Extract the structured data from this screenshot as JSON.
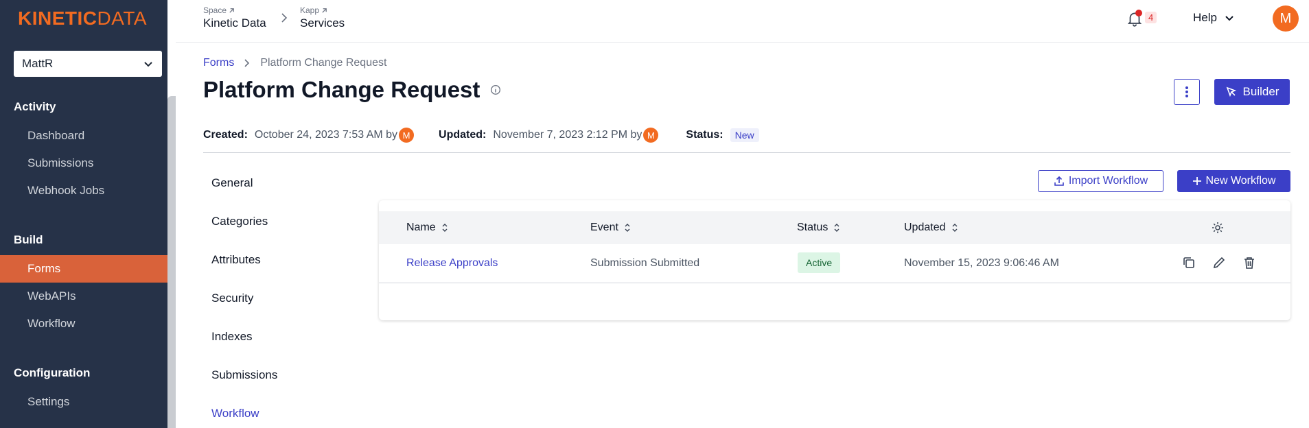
{
  "brand": {
    "logo_bold": "KINETIC",
    "logo_light": "DATA"
  },
  "space_select": {
    "value": "MattR"
  },
  "sidebar": {
    "sections": [
      {
        "title": "Activity",
        "items": [
          "Dashboard",
          "Submissions",
          "Webhook Jobs"
        ]
      },
      {
        "title": "Build",
        "items": [
          "Forms",
          "WebAPIs",
          "Workflow"
        ]
      },
      {
        "title": "Configuration",
        "items": [
          "Settings"
        ]
      }
    ],
    "active_item": "Forms"
  },
  "topbar": {
    "space_label": "Space",
    "space_name": "Kinetic Data",
    "kapp_label": "Kapp",
    "kapp_name": "Services",
    "notification_count": "4",
    "help_label": "Help",
    "avatar_initial": "M"
  },
  "breadcrumb": {
    "parent": "Forms",
    "current": "Platform Change Request"
  },
  "page": {
    "title": "Platform Change Request",
    "builder_label": "Builder",
    "created_label": "Created:",
    "created_value": "October 24, 2023 7:53 AM by",
    "updated_label": "Updated:",
    "updated_value": "November 7, 2023 2:12 PM by",
    "status_label": "Status:",
    "status_value": "New",
    "author_initial": "M"
  },
  "subnav": [
    "General",
    "Categories",
    "Attributes",
    "Security",
    "Indexes",
    "Submissions",
    "Workflow"
  ],
  "subnav_active": "Workflow",
  "actions": {
    "import_label": "Import Workflow",
    "new_label": "New Workflow"
  },
  "table": {
    "columns": [
      "Name",
      "Event",
      "Status",
      "Updated"
    ],
    "rows": [
      {
        "name": "Release Approvals",
        "event": "Submission Submitted",
        "status": "Active",
        "updated": "November 15, 2023 9:06:46 AM"
      }
    ]
  },
  "colors": {
    "accent": "#3b3fc7",
    "brand": "#f26b21",
    "sidebar": "#263248",
    "active_nav": "#d9623a"
  }
}
